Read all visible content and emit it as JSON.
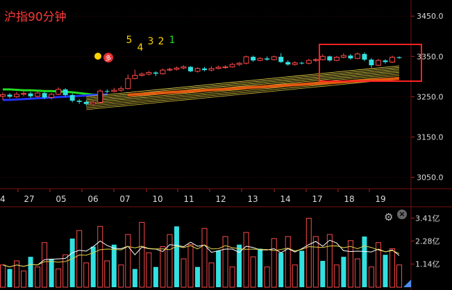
{
  "title": "沪指90分钟",
  "signal_numbers": [
    "5",
    "4",
    "3",
    "2",
    "1"
  ],
  "signal_colors": [
    "#ffd400",
    "#ffd400",
    "#ffd400",
    "#ffd400",
    "#22dd22"
  ],
  "badge_text": "多",
  "chart_data": {
    "type": "candlestick",
    "price_axis": {
      "ticks": [
        3450.0,
        3350.0,
        3250.0,
        3150.0,
        3050.0
      ],
      "labels": [
        "3450.0",
        "3350.0",
        "3250.0",
        "3150.0",
        "3050.0"
      ]
    },
    "date_labels": [
      "4",
      "27",
      "05",
      "06",
      "07",
      "10",
      "11",
      "12",
      "13",
      "14",
      "17",
      "18",
      "19"
    ],
    "volume_axis": {
      "labels": [
        "3.41亿",
        "2.28亿",
        "1.14亿"
      ],
      "ticks": [
        3.41,
        2.28,
        1.14
      ]
    },
    "candles": [
      [
        3251,
        3255,
        3242,
        3260
      ],
      [
        3255,
        3250,
        3246,
        3259
      ],
      [
        3250,
        3256,
        3247,
        3262
      ],
      [
        3256,
        3258,
        3251,
        3264
      ],
      [
        3258,
        3251,
        3246,
        3262
      ],
      [
        3251,
        3259,
        3248,
        3265
      ],
      [
        3259,
        3248,
        3244,
        3262
      ],
      [
        3248,
        3256,
        3243,
        3259
      ],
      [
        3256,
        3268,
        3254,
        3273
      ],
      [
        3268,
        3254,
        3250,
        3271
      ],
      [
        3254,
        3240,
        3236,
        3258
      ],
      [
        3240,
        3237,
        3232,
        3244
      ],
      [
        3237,
        3232,
        3228,
        3241
      ],
      [
        3232,
        3236,
        3229,
        3240
      ],
      [
        3236,
        3264,
        3234,
        3268
      ],
      [
        3264,
        3263,
        3258,
        3268
      ],
      [
        3263,
        3266,
        3260,
        3272
      ],
      [
        3266,
        3270,
        3262,
        3276
      ],
      [
        3270,
        3295,
        3268,
        3305
      ],
      [
        3295,
        3303,
        3293,
        3317
      ],
      [
        3303,
        3306,
        3300,
        3310
      ],
      [
        3306,
        3310,
        3303,
        3314
      ],
      [
        3310,
        3307,
        3301,
        3313
      ],
      [
        3307,
        3316,
        3305,
        3320
      ],
      [
        3316,
        3318,
        3313,
        3322
      ],
      [
        3318,
        3321,
        3315,
        3325
      ],
      [
        3321,
        3324,
        3318,
        3328
      ],
      [
        3324,
        3313,
        3311,
        3326
      ],
      [
        3313,
        3320,
        3310,
        3323
      ],
      [
        3320,
        3316,
        3313,
        3324
      ],
      [
        3316,
        3320,
        3313,
        3325
      ],
      [
        3320,
        3323,
        3318,
        3327
      ],
      [
        3322,
        3324,
        3319,
        3328
      ],
      [
        3324,
        3330,
        3322,
        3334
      ],
      [
        3330,
        3333,
        3326,
        3336
      ],
      [
        3333,
        3349,
        3330,
        3352
      ],
      [
        3349,
        3340,
        3337,
        3352
      ],
      [
        3340,
        3345,
        3338,
        3348
      ],
      [
        3345,
        3342,
        3339,
        3350
      ],
      [
        3342,
        3349,
        3340,
        3352
      ],
      [
        3349,
        3336,
        3334,
        3358
      ],
      [
        3336,
        3330,
        3327,
        3340
      ],
      [
        3330,
        3334,
        3327,
        3338
      ],
      [
        3334,
        3333,
        3330,
        3337
      ],
      [
        3333,
        3340,
        3330,
        3344
      ],
      [
        3340,
        3342,
        3336,
        3346
      ],
      [
        3342,
        3350,
        3340,
        3355
      ],
      [
        3350,
        3340,
        3337,
        3352
      ],
      [
        3340,
        3348,
        3338,
        3351
      ],
      [
        3348,
        3352,
        3345,
        3358
      ],
      [
        3352,
        3345,
        3342,
        3356
      ],
      [
        3345,
        3356,
        3343,
        3360
      ],
      [
        3356,
        3342,
        3338,
        3360
      ],
      [
        3342,
        3328,
        3322,
        3346
      ],
      [
        3328,
        3340,
        3326,
        3344
      ],
      [
        3340,
        3336,
        3332,
        3343
      ],
      [
        3336,
        3348,
        3334,
        3352
      ],
      [
        3348,
        3346,
        3344,
        3350
      ]
    ],
    "ma_lines": [
      {
        "color": "#22dd22",
        "values": [
          3268,
          3268,
          3267,
          3266,
          3266,
          3265,
          3264,
          3264,
          3263,
          3262,
          3261,
          3259,
          3257,
          3255,
          3255,
          3256
        ]
      },
      {
        "color": "#2233ff",
        "values": [
          3242,
          3242,
          3243,
          3244,
          3245,
          3246,
          3247,
          3248,
          3249,
          3250,
          3251,
          3252,
          3253,
          3254,
          3255,
          3256
        ]
      }
    ],
    "volumes": [
      1.1,
      0.9,
      1.3,
      0.8,
      1.5,
      1.0,
      2.2,
      1.4,
      0.9,
      1.6,
      2.4,
      2.8,
      1.2,
      2.0,
      3.0,
      1.3,
      2.1,
      1.1,
      2.6,
      0.9,
      3.2,
      1.7,
      1.0,
      2.0,
      2.6,
      3.0,
      1.4,
      2.1,
      1.0,
      2.9,
      1.2,
      1.8,
      2.5,
      1.0,
      2.1,
      2.7,
      1.5,
      1.9,
      1.0,
      2.4,
      1.7,
      2.5,
      1.1,
      1.8,
      3.4,
      2.5,
      1.3,
      2.6,
      1.1,
      1.5,
      2.3,
      1.4,
      2.5,
      1.0,
      2.2,
      1.6,
      1.9,
      1.1
    ],
    "legend": "none"
  }
}
